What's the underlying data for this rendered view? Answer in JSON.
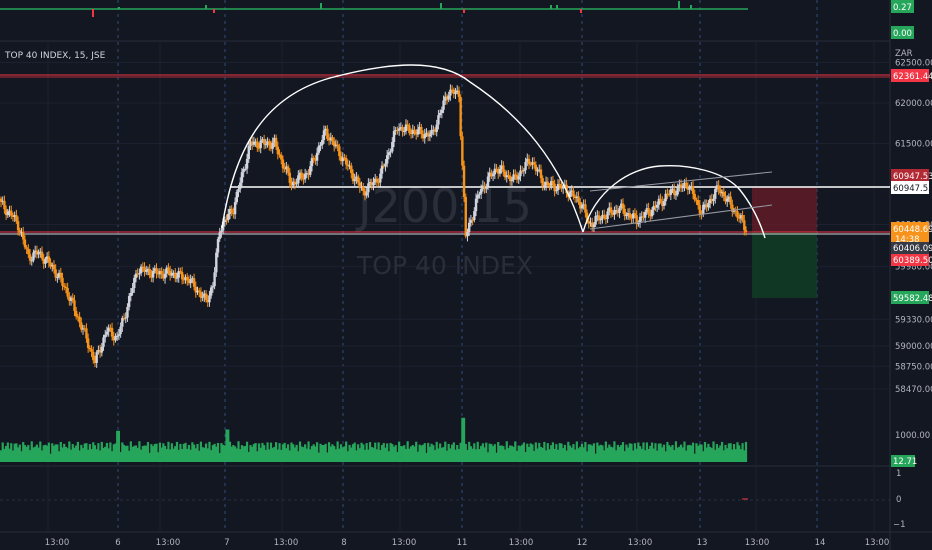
{
  "symbol_title": "TOP 40 INDEX, 15, JSE",
  "watermark": {
    "ticker_partial": "J200",
    "ticker_suffix": "15",
    "name": "TOP 40 INDEX"
  },
  "currency": "ZAR",
  "colors": {
    "background": "#131722",
    "bull": "#d1d4dc",
    "bear": "#f7931a",
    "resistance": "#f23645",
    "overlay": "#ffffff",
    "volume": "#26a65b",
    "stop_zone": "#6b1e28",
    "target_zone": "#0f3d24",
    "indicator_pos": "#26a65b",
    "indicator_neg": "#f23645"
  },
  "top_indicator": {
    "value_badge": "0.27",
    "zero_badge": "0.00"
  },
  "price_axis": {
    "ticks": [
      "62500.00",
      "62000.00",
      "61500.00",
      "60500.00",
      "59980.00",
      "59330.00",
      "59000.00",
      "58750.00",
      "58470.00"
    ],
    "tick_values": [
      62500,
      62000,
      61500,
      60500,
      59980,
      59330,
      59000,
      58750,
      58470
    ]
  },
  "price_labels": {
    "resistance_top": "62361.44",
    "stop_level": "60947.53",
    "neckline": "60947.53",
    "current_price": "60448.69",
    "countdown": "14:38",
    "support_high": "60406.09",
    "support_low": "60389.50",
    "target": "59582.48"
  },
  "volume_panel": {
    "axis_label": "1000.00",
    "value_badge": "12.71"
  },
  "bottom_indicator": {
    "ticks": [
      "1",
      "0",
      "−1"
    ]
  },
  "time_axis": [
    "13:00",
    "6",
    "13:00",
    "7",
    "13:00",
    "8",
    "13:00",
    "11",
    "13:00",
    "12",
    "13:00",
    "13",
    "13:00",
    "14",
    "13:00"
  ],
  "chart_data": {
    "type": "candlestick",
    "title": "TOP 40 INDEX, 15, JSE",
    "xlabel": "",
    "ylabel": "",
    "x_days": [
      "6",
      "7",
      "8",
      "11",
      "12",
      "13",
      "14"
    ],
    "ylim": [
      58300,
      62750
    ],
    "levels": {
      "resistance": 62361.44,
      "neckline": 60947.53,
      "support": 60406.09,
      "support_low": 60389.5,
      "target": 59582.48,
      "current": 60448.69
    },
    "anchors": [
      [
        0,
        60750
      ],
      [
        6,
        60620
      ],
      [
        10,
        60500
      ],
      [
        16,
        60100
      ],
      [
        22,
        60150
      ],
      [
        30,
        59980
      ],
      [
        38,
        59700
      ],
      [
        48,
        59200
      ],
      [
        55,
        58800
      ],
      [
        62,
        59200
      ],
      [
        68,
        59100
      ],
      [
        72,
        59350
      ],
      [
        80,
        59950
      ],
      [
        90,
        59900
      ],
      [
        100,
        59900
      ],
      [
        110,
        59820
      ],
      [
        120,
        59550
      ],
      [
        124,
        59750
      ],
      [
        128,
        60450
      ],
      [
        136,
        60700
      ],
      [
        146,
        61500
      ],
      [
        160,
        61500
      ],
      [
        170,
        61000
      ],
      [
        180,
        61150
      ],
      [
        190,
        61650
      ],
      [
        202,
        61250
      ],
      [
        212,
        60900
      ],
      [
        222,
        61100
      ],
      [
        232,
        61700
      ],
      [
        242,
        61650
      ],
      [
        252,
        61600
      ],
      [
        262,
        62150
      ],
      [
        268,
        62100
      ],
      [
        272,
        60350
      ],
      [
        280,
        60900
      ],
      [
        290,
        61200
      ],
      [
        300,
        61050
      ],
      [
        310,
        61300
      ],
      [
        318,
        61000
      ],
      [
        330,
        60950
      ],
      [
        340,
        60750
      ],
      [
        344,
        60500
      ],
      [
        352,
        60600
      ],
      [
        362,
        60700
      ],
      [
        372,
        60550
      ],
      [
        382,
        60700
      ],
      [
        392,
        60900
      ],
      [
        402,
        61000
      ],
      [
        410,
        60650
      ],
      [
        420,
        60950
      ],
      [
        430,
        60650
      ],
      [
        436,
        60450
      ]
    ],
    "volume_spikes": {
      "118": 1200,
      "227": 1250,
      "463": 1700
    },
    "volume_base": 300
  }
}
